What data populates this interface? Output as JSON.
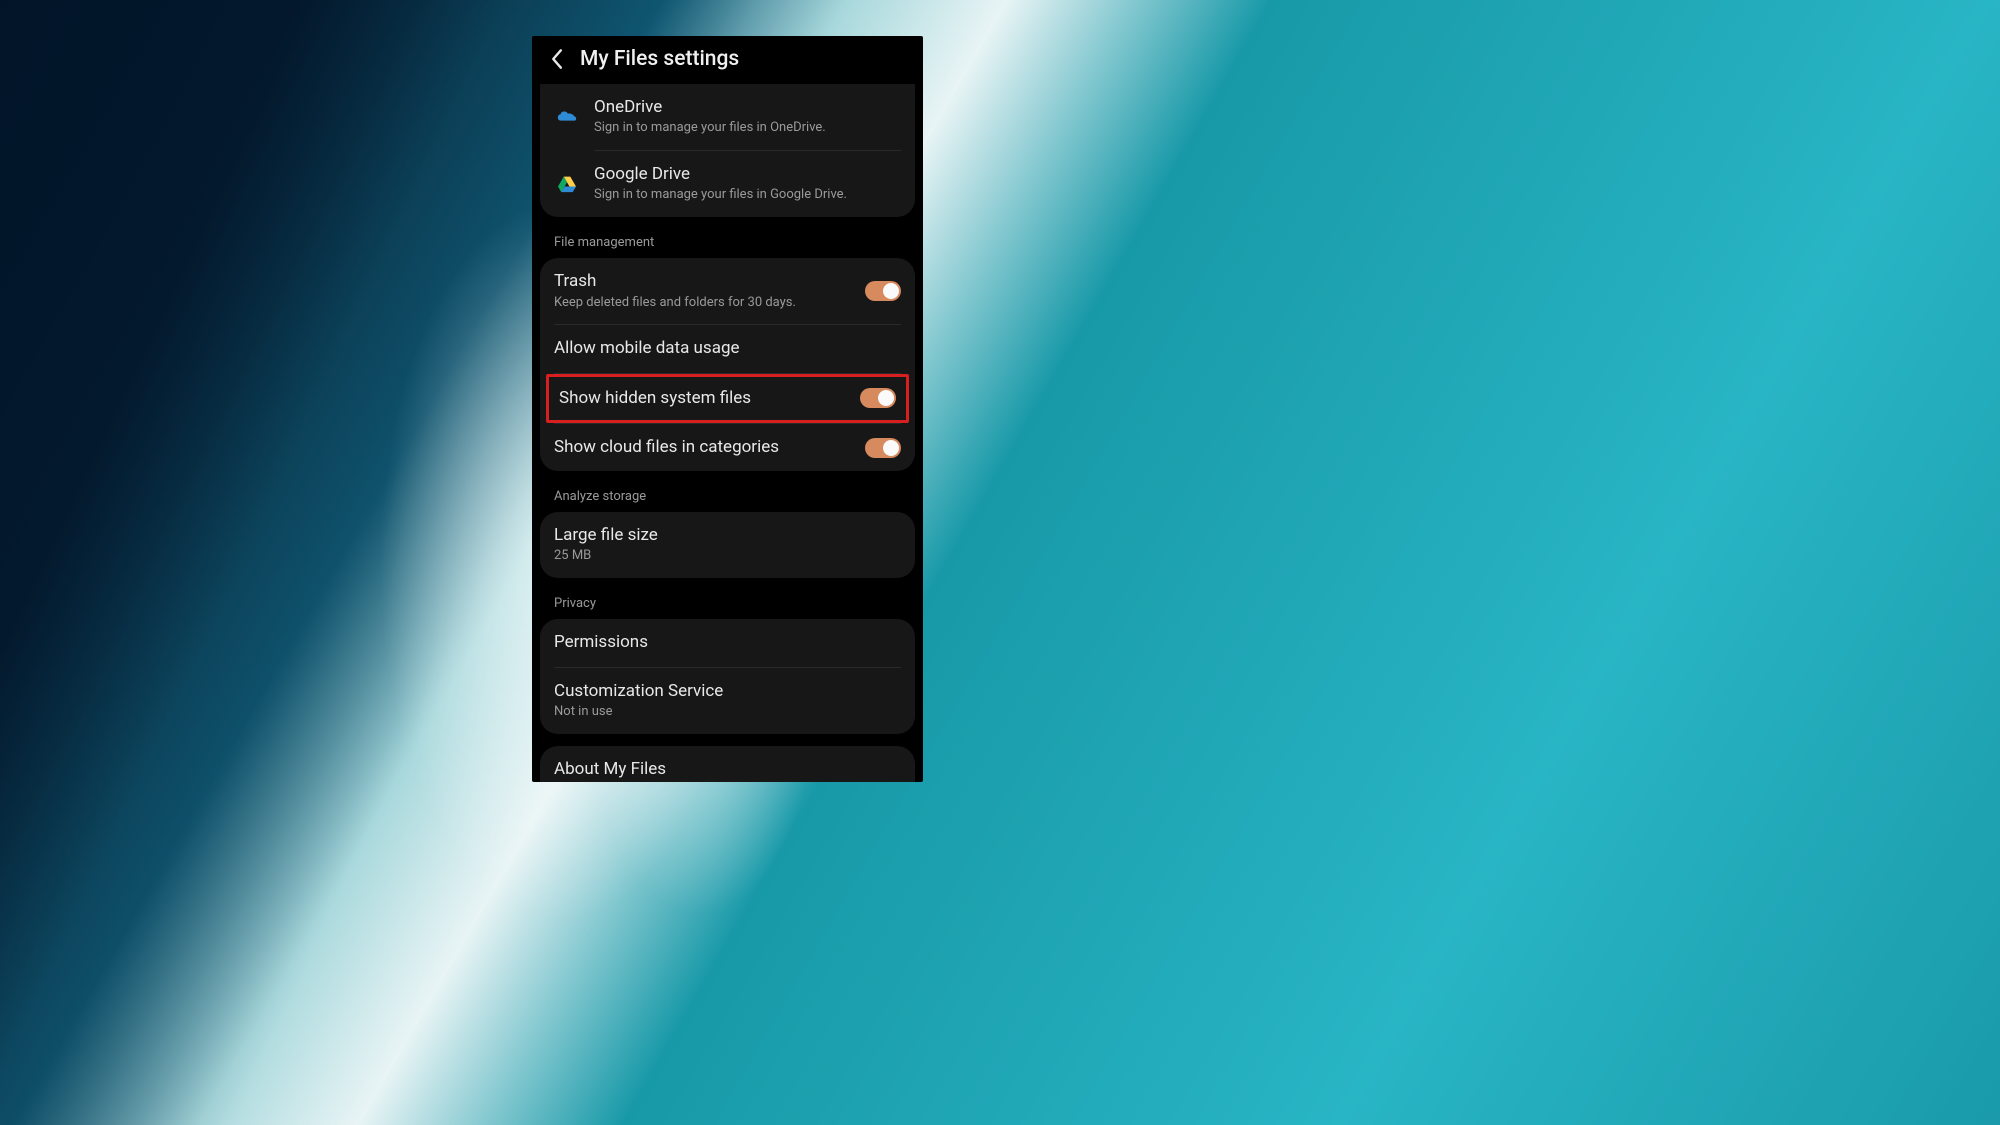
{
  "header": {
    "title": "My Files settings"
  },
  "cloud": {
    "onedrive": {
      "title": "OneDrive",
      "subtitle": "Sign in to manage your files in OneDrive."
    },
    "gdrive": {
      "title": "Google Drive",
      "subtitle": "Sign in to manage your files in Google Drive."
    }
  },
  "sections": {
    "file_management": "File management",
    "analyze_storage": "Analyze storage",
    "privacy": "Privacy"
  },
  "file_mgmt": {
    "trash": {
      "title": "Trash",
      "subtitle": "Keep deleted files and folders for 30 days."
    },
    "mobile_data": {
      "title": "Allow mobile data usage"
    },
    "hidden_files": {
      "title": "Show hidden system files"
    },
    "cloud_files": {
      "title": "Show cloud files in categories"
    }
  },
  "analyze": {
    "large_file": {
      "title": "Large file size",
      "subtitle": "25 MB"
    }
  },
  "privacy": {
    "permissions": {
      "title": "Permissions"
    },
    "customization": {
      "title": "Customization Service",
      "subtitle": "Not in use"
    }
  },
  "about": {
    "title": "About My Files"
  }
}
